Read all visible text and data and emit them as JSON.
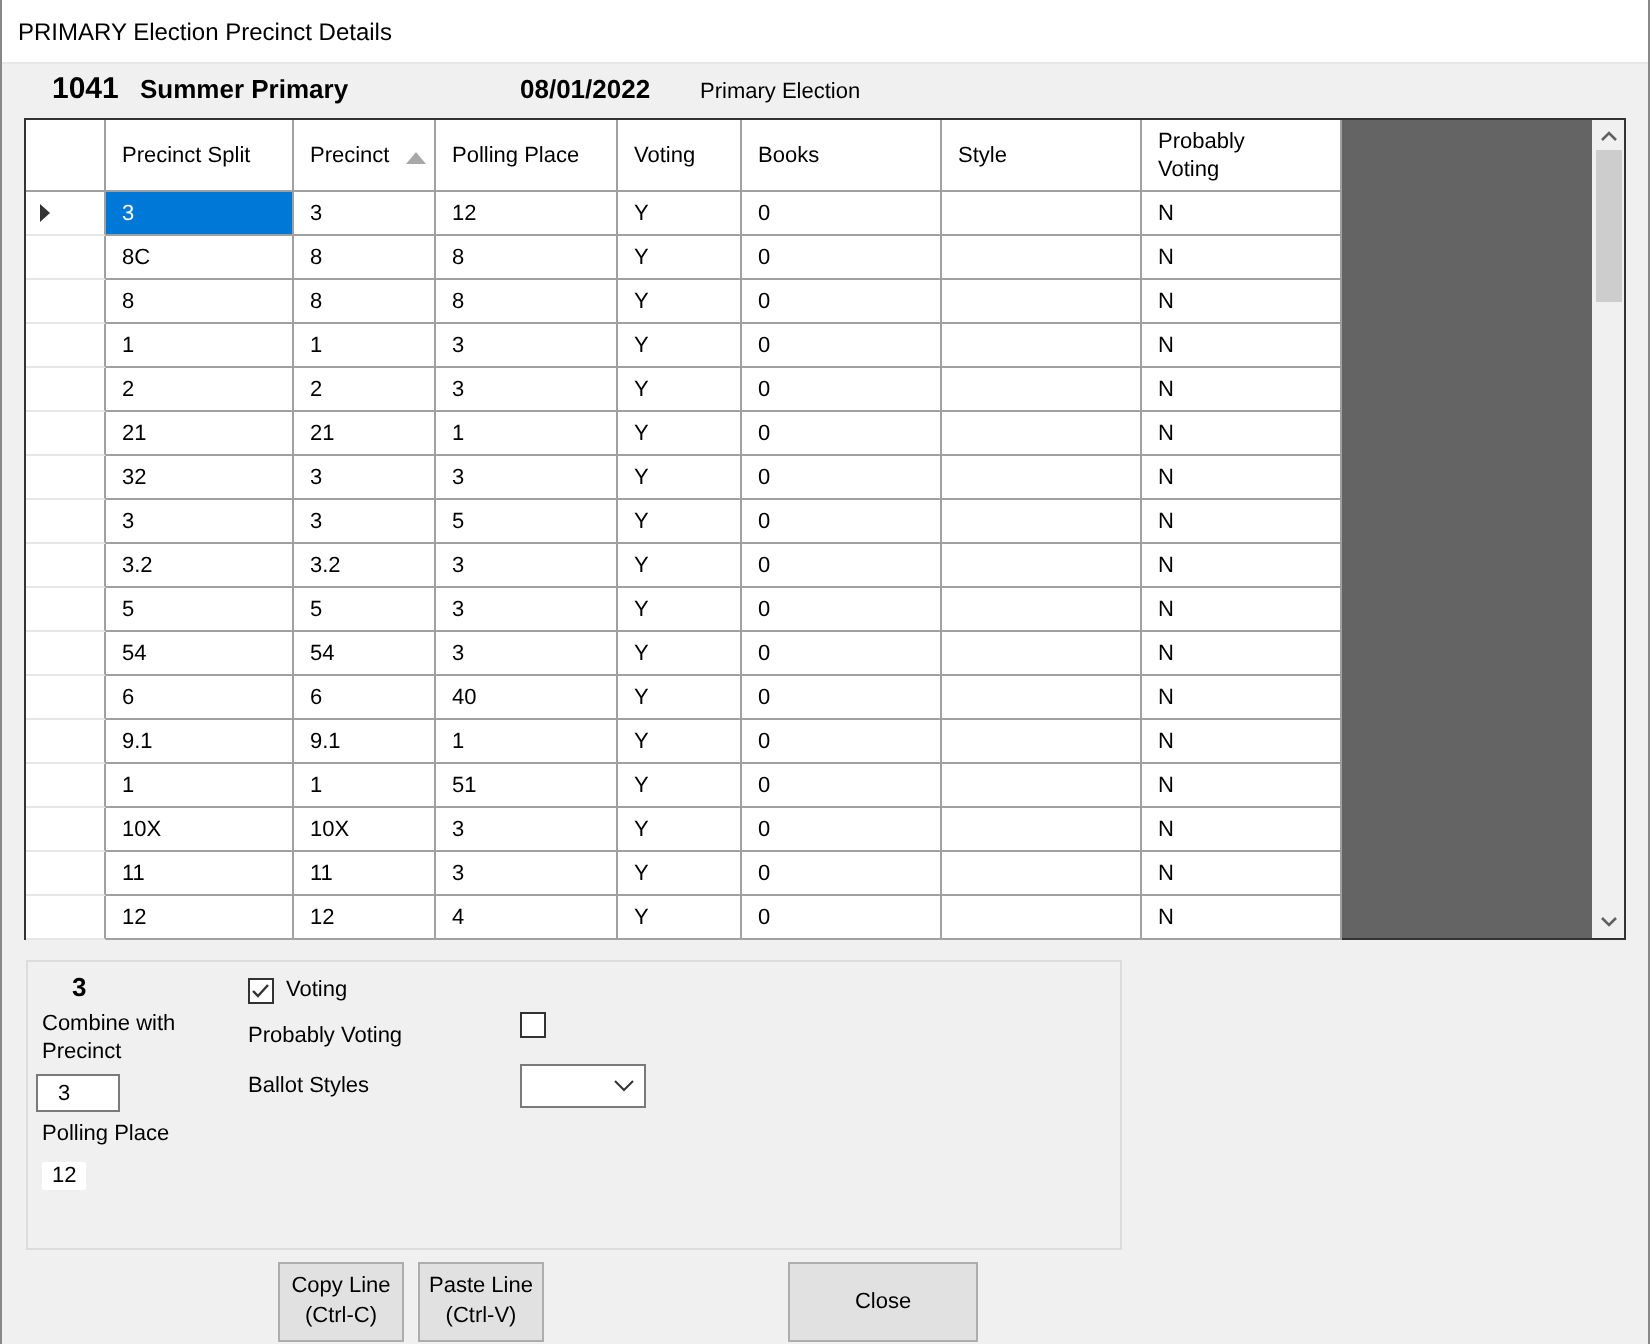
{
  "window": {
    "title": "PRIMARY Election Precinct Details"
  },
  "header": {
    "election_number": "1041",
    "election_name": "Summer Primary",
    "date": "08/01/2022",
    "election_type": "Primary Election"
  },
  "grid": {
    "columns": [
      {
        "label": "Precinct Split",
        "sorted": false
      },
      {
        "label": "Precinct",
        "sorted": true
      },
      {
        "label": "Polling Place",
        "sorted": false
      },
      {
        "label": "Voting",
        "sorted": false
      },
      {
        "label": "Books",
        "sorted": false
      },
      {
        "label": "Style",
        "sorted": false
      },
      {
        "label": "Probably Voting",
        "sorted": false
      }
    ],
    "rows": [
      {
        "selected": true,
        "precinct_split": "3",
        "precinct": "3",
        "polling_place": "12",
        "voting": "Y",
        "books": "0",
        "probably_voting": "N"
      },
      {
        "selected": false,
        "precinct_split": "8C",
        "precinct": "8",
        "polling_place": "8",
        "voting": "Y",
        "books": "0",
        "probably_voting": "N"
      },
      {
        "selected": false,
        "precinct_split": "8",
        "precinct": "8",
        "polling_place": "8",
        "voting": "Y",
        "books": "0",
        "probably_voting": "N"
      },
      {
        "selected": false,
        "precinct_split": "1",
        "precinct": "1",
        "polling_place": "3",
        "voting": "Y",
        "books": "0",
        "probably_voting": "N"
      },
      {
        "selected": false,
        "precinct_split": "2",
        "precinct": "2",
        "polling_place": "3",
        "voting": "Y",
        "books": "0",
        "probably_voting": "N"
      },
      {
        "selected": false,
        "precinct_split": "21",
        "precinct": "21",
        "polling_place": "1",
        "voting": "Y",
        "books": "0",
        "probably_voting": "N"
      },
      {
        "selected": false,
        "precinct_split": "32",
        "precinct": "3",
        "polling_place": "3",
        "voting": "Y",
        "books": "0",
        "probably_voting": "N"
      },
      {
        "selected": false,
        "precinct_split": "3",
        "precinct": "3",
        "polling_place": "5",
        "voting": "Y",
        "books": "0",
        "probably_voting": "N"
      },
      {
        "selected": false,
        "precinct_split": "3.2",
        "precinct": "3.2",
        "polling_place": "3",
        "voting": "Y",
        "books": "0",
        "probably_voting": "N"
      },
      {
        "selected": false,
        "precinct_split": "5",
        "precinct": "5",
        "polling_place": "3",
        "voting": "Y",
        "books": "0",
        "probably_voting": "N"
      },
      {
        "selected": false,
        "precinct_split": "54",
        "precinct": "54",
        "polling_place": "3",
        "voting": "Y",
        "books": "0",
        "probably_voting": "N"
      },
      {
        "selected": false,
        "precinct_split": "6",
        "precinct": "6",
        "polling_place": "40",
        "voting": "Y",
        "books": "0",
        "probably_voting": "N"
      },
      {
        "selected": false,
        "precinct_split": "9.1",
        "precinct": "9.1",
        "polling_place": "1",
        "voting": "Y",
        "books": "0",
        "probably_voting": "N"
      },
      {
        "selected": false,
        "precinct_split": "1",
        "precinct": "1",
        "polling_place": "51",
        "voting": "Y",
        "books": "0",
        "probably_voting": "N"
      },
      {
        "selected": false,
        "precinct_split": "10X",
        "precinct": "10X",
        "polling_place": "3",
        "voting": "Y",
        "books": "0",
        "probably_voting": "N"
      },
      {
        "selected": false,
        "precinct_split": "11",
        "precinct": "11",
        "polling_place": "3",
        "voting": "Y",
        "books": "0",
        "probably_voting": "N"
      },
      {
        "selected": false,
        "precinct_split": "12",
        "precinct": "12",
        "polling_place": "4",
        "voting": "Y",
        "books": "0",
        "probably_voting": "N"
      }
    ]
  },
  "detail": {
    "precinct_split": "3",
    "combine_label": "Combine with Precinct",
    "combine_value": "3",
    "polling_place_label": "Polling Place",
    "polling_place_value": "12",
    "voting": {
      "label": "Voting",
      "checked": true
    },
    "probably_voting": {
      "label": "Probably Voting",
      "checked": false
    },
    "ballot_styles": {
      "label": "Ballot Styles"
    }
  },
  "buttons": [
    {
      "label": "Copy Line\n(Ctrl-C)",
      "kind": "small"
    },
    {
      "label": "Paste Line\n(Ctrl-V)",
      "kind": "small"
    },
    {
      "label": "Close",
      "kind": "wide"
    }
  ]
}
